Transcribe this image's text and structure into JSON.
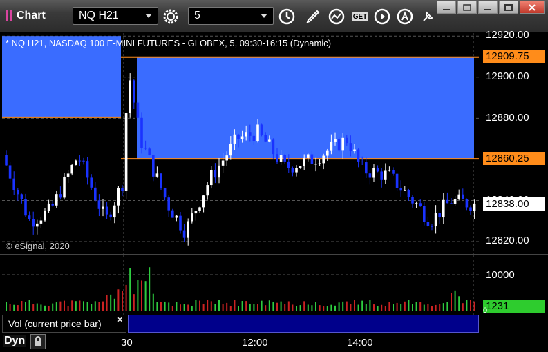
{
  "titlebar": {
    "app_title": "Chart",
    "symbol_value": "NQ H21",
    "interval_value": "5",
    "get_label": "GET"
  },
  "toolbar_icons": [
    "gear-icon",
    "clock-icon",
    "pencil-icon",
    "indicator-icon",
    "get-data-icon",
    "play-icon",
    "alert-icon",
    "pin-icon"
  ],
  "window_controls": [
    "minimize-icon",
    "restore-icon",
    "maximize-icon",
    "close-icon"
  ],
  "chart": {
    "header": "* NQ H21, NASDAQ 100 E-MINI FUTURES - GLOBEX, 5, 09:30-16:15 (Dynamic)",
    "copyright": "© eSignal, 2020",
    "price_ticks": [
      "12920.00",
      "12900.00",
      "12880.00",
      "12860.00",
      "12840.00",
      "12820.00"
    ],
    "upper_level": "12909.75",
    "lower_level": "12860.25",
    "last_price": "12838.00",
    "colors": {
      "zone": "#3a6cff",
      "up": "#ffffff",
      "down": "#1a33ff",
      "level": "#ff8c1a",
      "last": "#ffffff"
    }
  },
  "volume": {
    "label": "Vol (current price bar)",
    "close": "×",
    "tick": "10000",
    "zero": "0",
    "current": "1231",
    "colors": {
      "up": "#2ecc40",
      "down": "#cc2222",
      "tag": "#2ecc2e"
    }
  },
  "time_axis": {
    "dyn_label": "Dyn",
    "ticks": [
      "30",
      "12:00",
      "14:00"
    ]
  }
}
